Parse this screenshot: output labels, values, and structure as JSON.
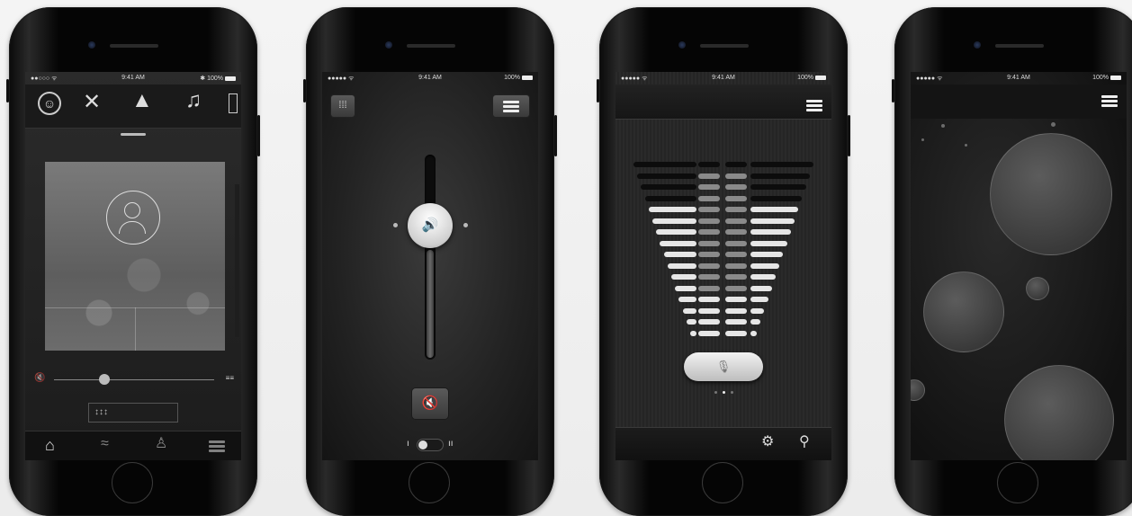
{
  "phones": [
    {
      "status": {
        "carrier": "●●○○○ ᯤ",
        "time": "9:41 AM",
        "battery": "✱ 100%"
      },
      "volume_icon_left": "🔇",
      "volume_icon_right": "≡≡",
      "eq_label": "↕↕↕",
      "icons": [
        "person-circle-icon",
        "fork-knife-icon",
        "tree-icon",
        "music-note-icon",
        "speaker-icon",
        "refresh-user-icon",
        "home-icon",
        "wifi-icon",
        "user-icon",
        "menu-icon"
      ]
    },
    {
      "status": {
        "carrier": "●●●●● ᯤ",
        "time": "9:41 AM",
        "battery": "100%"
      },
      "volume_glyph": "🔊",
      "mute_glyph": "🔇",
      "toggle_left": "ı",
      "toggle_right": "ıı",
      "icons": [
        "grid-icon",
        "menu-icon",
        "volume-icon",
        "mute-icon"
      ]
    },
    {
      "status": {
        "carrier": "●●●●● ᯤ",
        "time": "9:41 AM",
        "battery": "100%"
      },
      "mic_glyph": "🎙",
      "settings_glyph": "⚙",
      "link_glyph": "⚲",
      "page_dots": 3,
      "active_page": 2,
      "icons": [
        "menu-icon",
        "microphone-icon",
        "gear-icon",
        "link-icon"
      ]
    },
    {
      "status": {
        "carrier": "●●●●● ᯤ",
        "time": "9:41 AM",
        "battery": "100%"
      },
      "icons": [
        "menu-icon"
      ]
    }
  ],
  "colors": {
    "phone_body": "#050505",
    "screen_dark": "#141414",
    "accent_light": "#e6e6e6"
  }
}
